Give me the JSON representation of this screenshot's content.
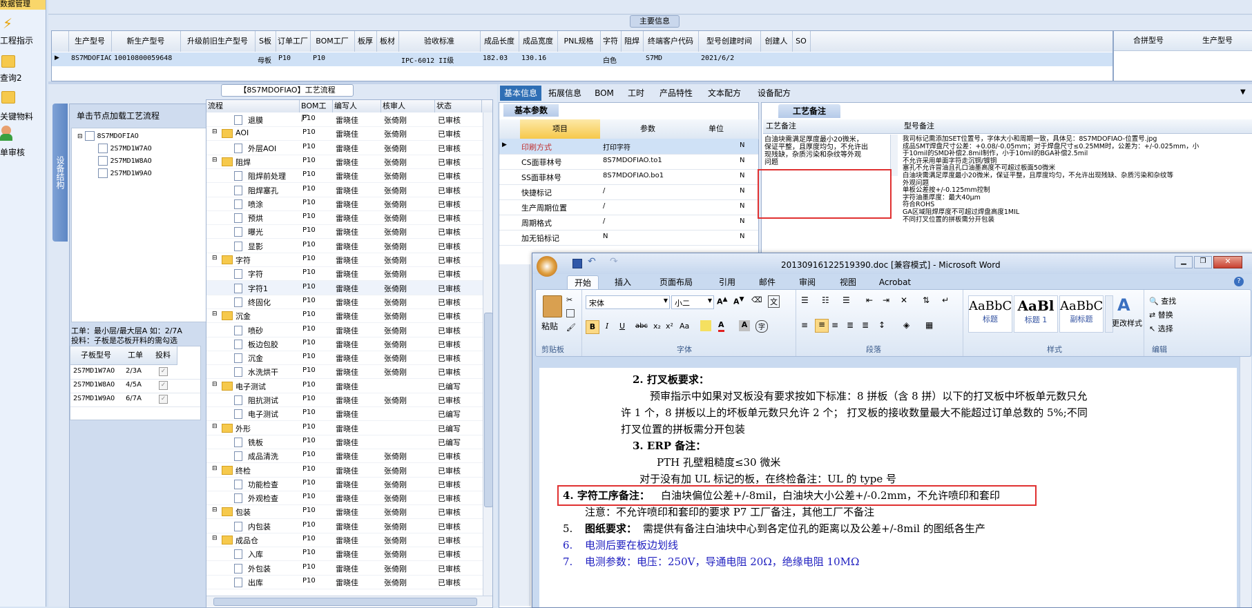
{
  "sidebar": {
    "items": [
      {
        "label": "数据管理"
      },
      {
        "label": "工程指示"
      },
      {
        "label": "查询2"
      },
      {
        "label": "关键物料"
      },
      {
        "label": "单审核"
      }
    ]
  },
  "main_info": {
    "title": "主要信息",
    "columns": [
      "生产型号",
      "新生产型号",
      "升级前旧生产型号",
      "S板",
      "订单工厂",
      "BOM工厂",
      "板厚",
      "板材",
      "验收标准",
      "成品长度",
      "成品宽度",
      "PNL规格",
      "字符",
      "阻焊",
      "终端客户代码",
      "型号创建时间",
      "创建人",
      "SO"
    ],
    "row": [
      "8S7MDOFIAO",
      "10010800059648",
      "",
      "母板",
      "P10",
      "P10",
      "",
      "",
      "IPC-6012 II级",
      "182.03",
      "130.16",
      "",
      "白色",
      "",
      "S7MD",
      "2021/6/2",
      "",
      ""
    ],
    "right_columns": [
      "合拼型号",
      "生产型号"
    ]
  },
  "process_panel": {
    "title": "【8S7MDOFIAO】工艺流程",
    "vertical_tab": "设备结构",
    "hint": "单击节点加载工艺流程",
    "tree_root": "8S7MDOFIAO",
    "tree_children": [
      "2S7MD1W7AO",
      "2S7MD1W8AO",
      "2S7MD1W9AO"
    ],
    "note_line1": "工单：最小层/最大层A 如：2/7A",
    "note_line2": "投料：子板是芯板开料的需勾选",
    "sub_columns": [
      "子板型号",
      "工单",
      "投料"
    ],
    "sub_rows": [
      {
        "model": "2S7MD1W7AO",
        "order": "2/3A"
      },
      {
        "model": "2S7MD1W8AO",
        "order": "4/5A"
      },
      {
        "model": "2S7MD1W9AO",
        "order": "6/7A"
      }
    ]
  },
  "flow_table": {
    "columns": [
      "流程",
      "BOM工厂",
      "编写人",
      "核审人",
      "状态"
    ],
    "rows": [
      {
        "level": 2,
        "name": "退膜",
        "f": "P10",
        "w": "雷晓佳",
        "r": "张倚刚",
        "s": "已审核"
      },
      {
        "level": 1,
        "name": "AOI",
        "f": "P10",
        "w": "雷晓佳",
        "r": "张倚刚",
        "s": "已审核"
      },
      {
        "level": 2,
        "name": "外层AOI",
        "f": "P10",
        "w": "雷晓佳",
        "r": "张倚刚",
        "s": "已审核"
      },
      {
        "level": 1,
        "name": "阻焊",
        "f": "P10",
        "w": "雷晓佳",
        "r": "张倚刚",
        "s": "已审核"
      },
      {
        "level": 2,
        "name": "阻焊前处理",
        "f": "P10",
        "w": "雷晓佳",
        "r": "张倚刚",
        "s": "已审核"
      },
      {
        "level": 2,
        "name": "阻焊塞孔",
        "f": "P10",
        "w": "雷晓佳",
        "r": "张倚刚",
        "s": "已审核"
      },
      {
        "level": 2,
        "name": "喷涂",
        "f": "P10",
        "w": "雷晓佳",
        "r": "张倚刚",
        "s": "已审核"
      },
      {
        "level": 2,
        "name": "预烘",
        "f": "P10",
        "w": "雷晓佳",
        "r": "张倚刚",
        "s": "已审核"
      },
      {
        "level": 2,
        "name": "曝光",
        "f": "P10",
        "w": "雷晓佳",
        "r": "张倚刚",
        "s": "已审核"
      },
      {
        "level": 2,
        "name": "显影",
        "f": "P10",
        "w": "雷晓佳",
        "r": "张倚刚",
        "s": "已审核"
      },
      {
        "level": 1,
        "name": "字符",
        "f": "P10",
        "w": "雷晓佳",
        "r": "张倚刚",
        "s": "已审核"
      },
      {
        "level": 2,
        "name": "字符",
        "f": "P10",
        "w": "雷晓佳",
        "r": "张倚刚",
        "s": "已审核"
      },
      {
        "level": 2,
        "name": "字符1",
        "f": "P10",
        "w": "雷晓佳",
        "r": "张倚刚",
        "s": "已审核"
      },
      {
        "level": 2,
        "name": "终固化",
        "f": "P10",
        "w": "雷晓佳",
        "r": "张倚刚",
        "s": "已审核"
      },
      {
        "level": 1,
        "name": "沉金",
        "f": "P10",
        "w": "雷晓佳",
        "r": "张倚刚",
        "s": "已审核"
      },
      {
        "level": 2,
        "name": "喷砂",
        "f": "P10",
        "w": "雷晓佳",
        "r": "张倚刚",
        "s": "已审核"
      },
      {
        "level": 2,
        "name": "板边包胶",
        "f": "P10",
        "w": "雷晓佳",
        "r": "张倚刚",
        "s": "已审核"
      },
      {
        "level": 2,
        "name": "沉金",
        "f": "P10",
        "w": "雷晓佳",
        "r": "张倚刚",
        "s": "已审核"
      },
      {
        "level": 2,
        "name": "水洗烘干",
        "f": "P10",
        "w": "雷晓佳",
        "r": "张倚刚",
        "s": "已审核"
      },
      {
        "level": 1,
        "name": "电子测试",
        "f": "P10",
        "w": "雷晓佳",
        "r": "",
        "s": "已编写"
      },
      {
        "level": 2,
        "name": "阻抗测试",
        "f": "P10",
        "w": "雷晓佳",
        "r": "张倚刚",
        "s": "已审核"
      },
      {
        "level": 2,
        "name": "电子测试",
        "f": "P10",
        "w": "雷晓佳",
        "r": "",
        "s": "已编写"
      },
      {
        "level": 1,
        "name": "外形",
        "f": "P10",
        "w": "雷晓佳",
        "r": "",
        "s": "已编写"
      },
      {
        "level": 2,
        "name": "铣板",
        "f": "P10",
        "w": "雷晓佳",
        "r": "",
        "s": "已编写"
      },
      {
        "level": 2,
        "name": "成品清洗",
        "f": "P10",
        "w": "雷晓佳",
        "r": "张倚刚",
        "s": "已审核"
      },
      {
        "level": 1,
        "name": "终检",
        "f": "P10",
        "w": "雷晓佳",
        "r": "张倚刚",
        "s": "已审核"
      },
      {
        "level": 2,
        "name": "功能检查",
        "f": "P10",
        "w": "雷晓佳",
        "r": "张倚刚",
        "s": "已审核"
      },
      {
        "level": 2,
        "name": "外观检查",
        "f": "P10",
        "w": "雷晓佳",
        "r": "张倚刚",
        "s": "已审核"
      },
      {
        "level": 1,
        "name": "包装",
        "f": "P10",
        "w": "雷晓佳",
        "r": "张倚刚",
        "s": "已审核"
      },
      {
        "level": 2,
        "name": "内包装",
        "f": "P10",
        "w": "雷晓佳",
        "r": "张倚刚",
        "s": "已审核"
      },
      {
        "level": 1,
        "name": "成品仓",
        "f": "P10",
        "w": "雷晓佳",
        "r": "张倚刚",
        "s": "已审核"
      },
      {
        "level": 2,
        "name": "入库",
        "f": "P10",
        "w": "雷晓佳",
        "r": "张倚刚",
        "s": "已审核"
      },
      {
        "level": 2,
        "name": "外包装",
        "f": "P10",
        "w": "雷晓佳",
        "r": "张倚刚",
        "s": "已审核"
      },
      {
        "level": 2,
        "name": "出库",
        "f": "P10",
        "w": "雷晓佳",
        "r": "张倚刚",
        "s": "已审核"
      }
    ]
  },
  "right_tabs": [
    "基本信息",
    "拓展信息",
    "BOM",
    "工时",
    "产品特性",
    "文本配方",
    "设备配方"
  ],
  "basic_params": {
    "title": "基本参数",
    "columns": [
      "项目",
      "参数",
      "单位"
    ],
    "rows": [
      {
        "item": "印刷方式",
        "param": "打印字符",
        "flag": "N"
      },
      {
        "item": "CS面菲林号",
        "param": "8S7MDOFIAO.to1",
        "flag": "N"
      },
      {
        "item": "SS面菲林号",
        "param": "8S7MDOFIAO.bo1",
        "flag": "N"
      },
      {
        "item": "快捷标记",
        "param": "/",
        "flag": "N"
      },
      {
        "item": "生产周期位置",
        "param": "/",
        "flag": "N"
      },
      {
        "item": "周期格式",
        "param": "/",
        "flag": "N"
      },
      {
        "item": "加无铅标记",
        "param": "N",
        "flag": "N"
      }
    ]
  },
  "process_notes": {
    "tab": "工艺备注",
    "col1": "工艺备注",
    "col2": "型号备注",
    "note1": [
      "白油块需满足厚度最小20微米，",
      "保证平整，且厚度均匀，不允许出",
      "现残缺，杂质污染和杂纹等外观",
      "问题"
    ],
    "note2": [
      "我司标记需添加SET位置号，字体大小和周期一致，具体见：8S7MDOFIAO-位置号.jpg",
      "成品SMT焊盘尺寸公差：+0.08/-0.05mm；对于焊盘尺寸≤0.25MM时，公差为：+/-0.025mm，小",
      "于10mil的SMD补偿2.8mil制作，小于10mil的BGA补偿2.5mil",
      "不允许采用单面字符走沉铜/镀铜",
      "塞孔不允许冒油且孔口油墨高度不可超过板面50微米",
      "白油块需满足厚度最小20微米，保证平整，且厚度均匀，不允许出现残缺、杂质污染和杂纹等",
      "外观问题",
      "单板公差按+/-0.125mm控制",
      "字符油墨厚度：最大40μm",
      "符合ROHS",
      "GA区域阻焊厚度不可超过焊盘高度1MIL",
      "不同打叉位置的拼板需分开包装"
    ]
  },
  "word": {
    "title": "20130916122519390.doc [兼容模式] - Microsoft Word",
    "ribbon_tabs": [
      "开始",
      "插入",
      "页面布局",
      "引用",
      "邮件",
      "审阅",
      "视图",
      "Acrobat"
    ],
    "clipboard_label": "剪贴板",
    "paste_label": "粘贴",
    "font_name": "宋体",
    "font_size": "小二",
    "font_group": "字体",
    "para_group": "段落",
    "style_group": "样式",
    "edit_group": "编辑",
    "styles": [
      {
        "preview": "AaBbC",
        "label": "标题"
      },
      {
        "preview": "AaBl",
        "label": "标题 1"
      },
      {
        "preview": "AaBbC",
        "label": "副标题"
      }
    ],
    "change_styles": "更改样式",
    "find": "查找",
    "replace": "替换",
    "select": "选择",
    "doc": {
      "h2": "2. 打叉板要求：",
      "p2a": "预审指示中如果对叉板没有要求按如下标准：8 拼板（含 8 拼）以下的打叉板中坏板单元数只允",
      "p2b": "许 1 个，8 拼板以上的坏板单元数只允许 2 个；  打叉板的接收数量最大不能超过订单总数的 5%;不同",
      "p2c": "打叉位置的拼板需分开包装",
      "h3": "3. ERP 备注：",
      "p3a": "PTH 孔壁粗糙度≤30 微米",
      "p3b": "对于没有加 UL 标记的板，在终检备注：UL 的 type 号",
      "h4": "4. 字符工序备注：",
      "p4": "白油块偏位公差+/-8mil，白油块大小公差+/-0.2mm，不允许喷印和套印",
      "p4n": "注意：不允许喷印和套印的要求 P7 工厂备注，其他工厂不备注",
      "n5": "5.",
      "h5": "图纸要求：",
      "p5": "需提供有备注白油块中心到各定位孔的距离以及公差+/-8mil 的图纸各生产",
      "n6": "6.",
      "p6": "电测后要在板边划线",
      "n7": "7.",
      "p7": "电测参数：电压：250V，导通电阻 20Ω，绝缘电阻 10MΩ"
    }
  },
  "colors": {
    "accent": "#2f6fb5",
    "highlight_red": "#e03030",
    "word_blue": "#2020c0"
  }
}
